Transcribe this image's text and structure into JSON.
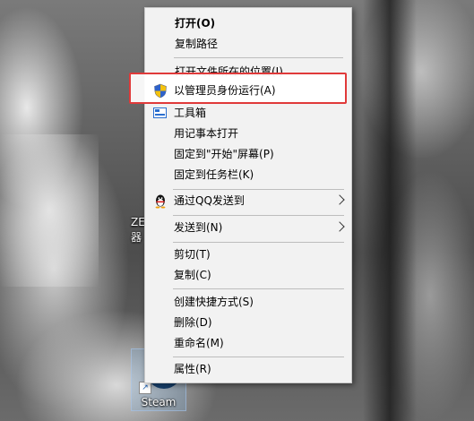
{
  "desktop": {
    "partial_label_lines": [
      "ZE",
      "器"
    ],
    "steam_label": "Steam"
  },
  "context_menu": {
    "items": [
      {
        "label": "打开(O)",
        "bold": true
      },
      {
        "label": "复制路径"
      },
      {
        "label": "打开文件所在的位置(I)"
      },
      {
        "label": "以管理员身份运行(A)",
        "icon": "uac-shield-icon",
        "highlighted": true
      },
      {
        "label": "工具箱",
        "icon": "toolbox-icon"
      },
      {
        "label": "用记事本打开"
      },
      {
        "label": "固定到\"开始\"屏幕(P)"
      },
      {
        "label": "固定到任务栏(K)"
      },
      {
        "label": "通过QQ发送到",
        "icon": "qq-penguin-icon",
        "submenu": true
      },
      {
        "label": "发送到(N)",
        "submenu": true
      },
      {
        "label": "剪切(T)"
      },
      {
        "label": "复制(C)"
      },
      {
        "label": "创建快捷方式(S)"
      },
      {
        "label": "删除(D)"
      },
      {
        "label": "重命名(M)"
      },
      {
        "label": "属性(R)"
      }
    ]
  },
  "colors": {
    "menu_background": "#f2f2f2",
    "highlight_border": "#e03a3a",
    "separator": "#bdbdbd"
  }
}
